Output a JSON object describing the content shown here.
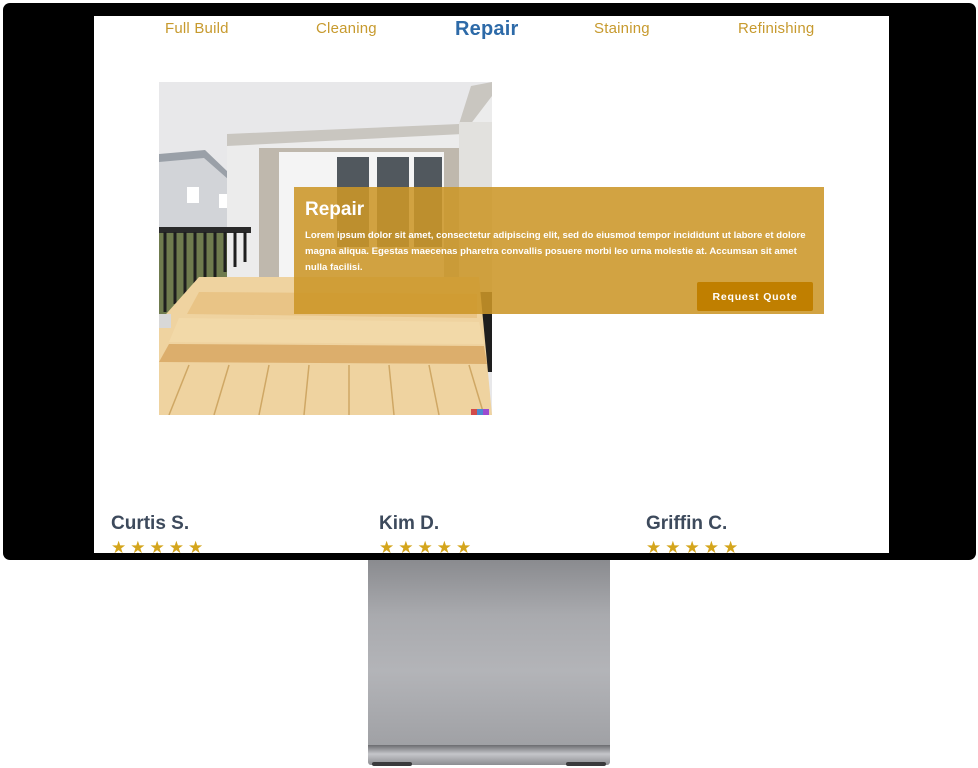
{
  "nav": {
    "items": [
      {
        "label": "Full Build",
        "active": false
      },
      {
        "label": "Cleaning",
        "active": false
      },
      {
        "label": "Repair",
        "active": true
      },
      {
        "label": "Staining",
        "active": false
      },
      {
        "label": "Refinishing",
        "active": false
      }
    ]
  },
  "hero": {
    "title": "Repair",
    "body": "Lorem ipsum dolor sit amet, consectetur adipiscing elit, sed do eiusmod tempor incididunt ut labore et dolore magna aliqua. Egestas maecenas pharetra convallis posuere morbi leo urna molestie at. Accumsan sit amet nulla facilisi.",
    "button_label": "Request Quote"
  },
  "reviews": [
    {
      "name": "Curtis S.",
      "rating": 5
    },
    {
      "name": "Kim D.",
      "rating": 5
    },
    {
      "name": "Griffin C.",
      "rating": 5
    }
  ],
  "colors": {
    "nav_text": "#c79a2e",
    "nav_active": "#2d6aa8",
    "overlay": "#cc9628",
    "button": "#c07f00",
    "star": "#d4a51c",
    "review_name": "#3d4a5c"
  }
}
